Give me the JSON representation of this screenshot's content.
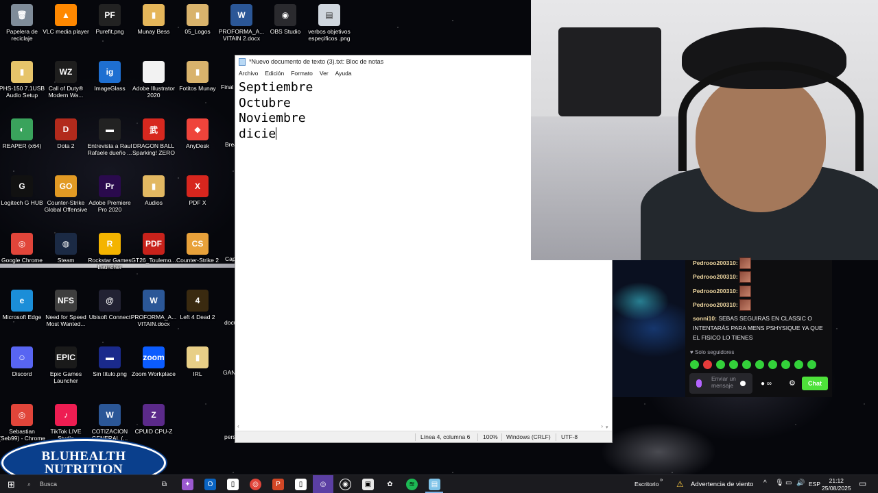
{
  "desktop": {
    "icons": [
      {
        "label": "Papelera de reciclaje",
        "icon": "recycle-bin-icon",
        "color": "#7f8c99",
        "glyph": "🗑"
      },
      {
        "label": "VLC media player",
        "icon": "vlc-icon",
        "color": "#ff8800",
        "glyph": "▲"
      },
      {
        "label": "Purefit.png",
        "icon": "image-file-icon",
        "color": "#222222",
        "glyph": "PF"
      },
      {
        "label": "Munay Bess",
        "icon": "folder-icon",
        "color": "#e5b65a",
        "glyph": "▮"
      },
      {
        "label": "05_Logos",
        "icon": "folder-icon",
        "color": "#d9b36c",
        "glyph": "▮"
      },
      {
        "label": "PROFORMA_A... VITAIN 2.docx",
        "icon": "word-icon",
        "color": "#2b5797",
        "glyph": "W"
      },
      {
        "label": "OBS Studio",
        "icon": "obs-icon",
        "color": "#2a2a2e",
        "glyph": "◉"
      },
      {
        "label": "verbos objetivos especificos .png",
        "icon": "image-file-icon",
        "color": "#cfd6de",
        "glyph": "▤"
      },
      {
        "label": "PHS-150 7.1USB Audio Setup",
        "icon": "folder-icon",
        "color": "#e6c46a",
        "glyph": "▮"
      },
      {
        "label": "Call of Duty® Modern Wa...",
        "icon": "cod-icon",
        "color": "#1e1e1e",
        "glyph": "WZ"
      },
      {
        "label": "ImageGlass",
        "icon": "imageglass-icon",
        "color": "#1e6fd1",
        "glyph": "ig"
      },
      {
        "label": "Adobe Illustrator 2020",
        "icon": "file-icon",
        "color": "#f2f2f2",
        "glyph": ""
      },
      {
        "label": "Fotitos Munay",
        "icon": "folder-icon",
        "color": "#d9b36c",
        "glyph": "▮"
      },
      {
        "label": "REAPER (x64)",
        "icon": "reaper-icon",
        "color": "#3aa35c",
        "glyph": "◐"
      },
      {
        "label": "Dota 2",
        "icon": "dota-icon",
        "color": "#b22a1c",
        "glyph": "D"
      },
      {
        "label": "Entrevista a Raul Rafaele dueño ...",
        "icon": "video-file-icon",
        "color": "#222222",
        "glyph": "▬"
      },
      {
        "label": "DRAGON BALL Sparking! ZERO",
        "icon": "dragonball-icon",
        "color": "#d7281f",
        "glyph": "武"
      },
      {
        "label": "AnyDesk",
        "icon": "anydesk-icon",
        "color": "#ef443b",
        "glyph": "◆"
      },
      {
        "label": "Logitech G HUB",
        "icon": "logitech-icon",
        "color": "#111111",
        "glyph": "G"
      },
      {
        "label": "Counter-Strike Global Offensive",
        "icon": "csgo-icon",
        "color": "#e29a24",
        "glyph": "GO"
      },
      {
        "label": "Adobe Premiere Pro 2020",
        "icon": "premiere-icon",
        "color": "#2a0a4d",
        "glyph": "Pr"
      },
      {
        "label": "Audios",
        "icon": "folder-icon",
        "color": "#e2b862",
        "glyph": "▮"
      },
      {
        "label": "PDF X",
        "icon": "pdf-icon",
        "color": "#d7261e",
        "glyph": "X"
      },
      {
        "label": "Google Chrome",
        "icon": "chrome-icon",
        "color": "#e1453a",
        "glyph": "◎"
      },
      {
        "label": "Steam",
        "icon": "steam-icon",
        "color": "#1b2a44",
        "glyph": "◍"
      },
      {
        "label": "Rockstar Games Launcher",
        "icon": "rockstar-icon",
        "color": "#f4b400",
        "glyph": "R"
      },
      {
        "label": "GT26_Toulemo...",
        "icon": "pdf-icon",
        "color": "#c8221b",
        "glyph": "PDF"
      },
      {
        "label": "Counter-Strike 2",
        "icon": "cs2-icon",
        "color": "#e8a13a",
        "glyph": "CS"
      },
      {
        "label": "Microsoft Edge",
        "icon": "edge-icon",
        "color": "#1b8ed8",
        "glyph": "e"
      },
      {
        "label": "Need for Speed Most Wanted...",
        "icon": "nfs-icon",
        "color": "#3e3e3e",
        "glyph": "NFS"
      },
      {
        "label": "Ubisoft Connect",
        "icon": "ubisoft-icon",
        "color": "#222233",
        "glyph": "@"
      },
      {
        "label": "PROFORMA_A... VITAIN.docx",
        "icon": "word-icon",
        "color": "#2b5797",
        "glyph": "W"
      },
      {
        "label": "Left 4 Dead 2",
        "icon": "l4d2-icon",
        "color": "#3a2a10",
        "glyph": "4"
      },
      {
        "label": "Discord",
        "icon": "discord-icon",
        "color": "#5865f2",
        "glyph": "☺"
      },
      {
        "label": "Epic Games Launcher",
        "icon": "epic-icon",
        "color": "#1a1a1a",
        "glyph": "EPIC"
      },
      {
        "label": "Sin título.png",
        "icon": "image-file-icon",
        "color": "#1a2a8c",
        "glyph": "▬"
      },
      {
        "label": "Zoom Workplace",
        "icon": "zoom-icon",
        "color": "#0b5cff",
        "glyph": "zoom"
      },
      {
        "label": "IRL",
        "icon": "folder-icon",
        "color": "#e8cf87",
        "glyph": "▮"
      },
      {
        "label": "Sebastian (Seb99) - Chrome",
        "icon": "chrome-icon",
        "color": "#e1453a",
        "glyph": "◎"
      },
      {
        "label": "TikTok LIVE Studio",
        "icon": "tiktok-icon",
        "color": "#ee1d52",
        "glyph": "♪"
      },
      {
        "label": "COTIZACION GENERAL (...",
        "icon": "word-icon",
        "color": "#2b5797",
        "glyph": "W"
      },
      {
        "label": "CPUID CPU-Z",
        "icon": "cpuz-icon",
        "color": "#5b2a8a",
        "glyph": "Z"
      }
    ],
    "partial_labels": [
      "Final",
      "Brea",
      "Cap",
      "docu",
      "GAN",
      "pers"
    ]
  },
  "notepad": {
    "title": "*Nuevo documento de texto (3).txt: Bloc de notas",
    "menu": [
      "Archivo",
      "Edición",
      "Formato",
      "Ver",
      "Ayuda"
    ],
    "lines": [
      "Septiembre",
      "Octubre",
      "Noviembre",
      "dicie"
    ],
    "status": {
      "position": "Línea 4, columna 6",
      "zoom": "100%",
      "line_endings": "Windows (CRLF)",
      "encoding": "UTF-8"
    }
  },
  "chat": {
    "messages": [
      {
        "user": "Pedrooo200310:",
        "text": ""
      },
      {
        "user": "Pedrooo200310:",
        "text": ""
      },
      {
        "user": "Pedrooo200310:",
        "text": ""
      },
      {
        "user": "Pedrooo200310:",
        "text": ""
      },
      {
        "user": "sonni10:",
        "text": "SEBAS SEGUIRAS EN CLASSIC O INTENTARÁS PARA MENS PSHYSIQUE YA QUE EL FISICO LO TIENES"
      }
    ],
    "mode": "Solo seguidores",
    "input_placeholder": "Enviar un mensaje",
    "send_label": "Chat",
    "tools_label": "∞",
    "colors": {
      "accent": "#4ee13a",
      "username": "#f1d9a2"
    }
  },
  "logo": {
    "line1": "BLUHEALTH",
    "line2": "NUTRITION"
  },
  "taskbar": {
    "search_placeholder": "Busca",
    "weather_location": "Escritorio",
    "weather_alert": "Advertencia de viento",
    "language": "ESP",
    "time": "21:12",
    "date": "25/08/2025"
  }
}
